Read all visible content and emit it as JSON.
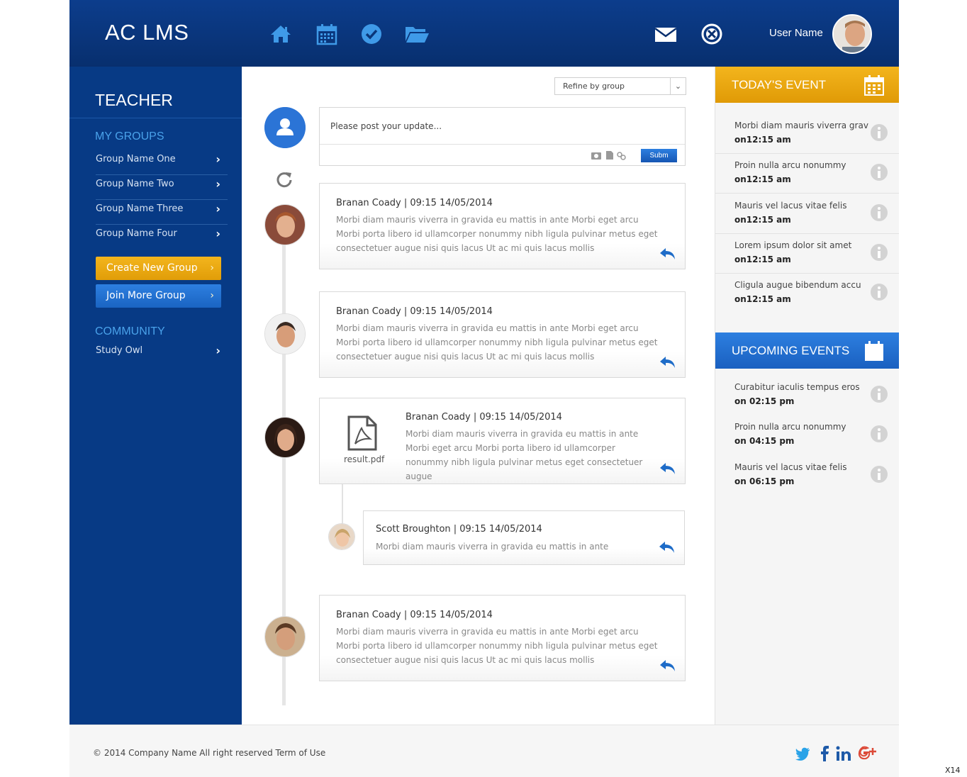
{
  "header": {
    "title": "AC LMS",
    "user_name": "User Name",
    "nav_icons": [
      "home-icon",
      "calendar-icon",
      "check-circle-icon",
      "folder-icon"
    ],
    "action_icons": [
      "mail-icon",
      "close-circle-icon"
    ]
  },
  "sidebar": {
    "title": "TEACHER",
    "groups_heading": "MY GROUPS",
    "groups": [
      "Group Name One",
      "Group Name Two",
      "Group Name Three",
      "Group Name Four"
    ],
    "create_button": "Create New Group",
    "join_button": "Join More Group",
    "community_heading": "COMMUNITY",
    "community_items": [
      "Study Owl"
    ]
  },
  "feed": {
    "refine_label": "Refine by group",
    "post_placeholder": "Please post your update...",
    "submit_label": "Subm",
    "posts": [
      {
        "author": "Branan Coady  |  09:15  14/05/2014",
        "text": "Morbi diam mauris viverra in gravida eu mattis in ante Morbi eget arcu Morbi porta libero id ullamcorper nonummy nibh ligula pulvinar metus eget consectetuer augue nisi quis lacus Ut ac mi quis lacus mollis"
      },
      {
        "author": "Branan Coady  |  09:15  14/05/2014",
        "text": "Morbi diam mauris viverra in gravida eu mattis in ante Morbi eget arcu Morbi porta libero id ullamcorper nonummy nibh ligula pulvinar metus eget consectetuer augue nisi quis lacus Ut ac mi quis lacus mollis"
      },
      {
        "author": "Branan Coady  |  09:15  14/05/2014",
        "text": "Morbi diam mauris viverra in gravida eu mattis in ante Morbi eget arcu Morbi porta libero id ullamcorper nonummy nibh ligula pulvinar metus eget consectetuer augue",
        "attachment": "result.pdf"
      },
      {
        "author": "Scott Broughton |  09:15  14/05/2014",
        "text": "Morbi diam mauris viverra in gravida eu mattis in ante"
      },
      {
        "author": "Branan Coady  |  09:15  14/05/2014",
        "text": "Morbi diam mauris viverra in gravida eu mattis in ante Morbi eget arcu Morbi porta libero id ullamcorper nonummy nibh ligula pulvinar metus eget consectetuer augue nisi quis lacus Ut ac mi quis lacus mollis"
      }
    ]
  },
  "right": {
    "today_heading": "TODAY'S EVENT",
    "today_events": [
      {
        "title": "Morbi diam mauris viverra grav",
        "time": "on12:15 am"
      },
      {
        "title": "Proin nulla arcu nonummy",
        "time": "on12:15 am"
      },
      {
        "title": "Mauris vel lacus vitae felis",
        "time": "on12:15 am"
      },
      {
        "title": "Lorem ipsum dolor sit amet",
        "time": "on12:15 am"
      },
      {
        "title": "Cligula augue bibendum accu",
        "time": "on12:15 am"
      }
    ],
    "upcoming_heading": "UPCOMING EVENTS",
    "upcoming_events": [
      {
        "title": "Curabitur iaculis tempus eros",
        "time": "on 02:15 pm"
      },
      {
        "title": "Proin nulla arcu nonummy",
        "time": "on 04:15 pm"
      },
      {
        "title": "Mauris vel lacus vitae felis",
        "time": "on 06:15 pm"
      }
    ]
  },
  "footer": {
    "copyright": "© 2014 Company Name  All right reserved  Term of Use",
    "social": [
      "twitter-icon",
      "facebook-icon",
      "linkedin-icon",
      "google-plus-icon"
    ]
  },
  "corner_label": "X14",
  "colors": {
    "brand_blue": "#0c3d8c",
    "sidebar_blue": "#073a85",
    "accent_yellow": "#f3b51d",
    "accent_blue": "#2d7fe0",
    "link_blue": "#4aa2ea"
  }
}
